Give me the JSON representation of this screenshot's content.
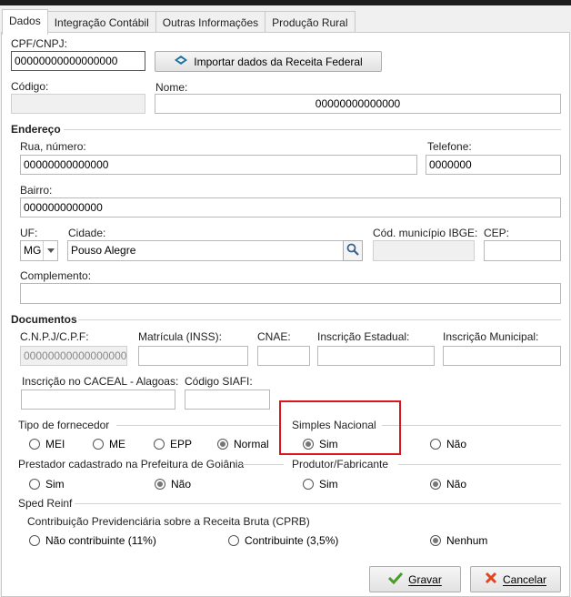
{
  "tabs": [
    "Dados",
    "Integração Contábil",
    "Outras Informações",
    "Produção Rural"
  ],
  "identificacao": {
    "cpf_label": "CPF/CNPJ:",
    "cpf_value": "00000000000000000",
    "import_button": "Importar dados da Receita Federal",
    "codigo_label": "Código:",
    "codigo_value": "",
    "nome_label": "Nome:",
    "nome_value": "00000000000000"
  },
  "endereco": {
    "title": "Endereço",
    "rua_label": "Rua, número:",
    "rua_value": "00000000000000",
    "telefone_label": "Telefone:",
    "telefone_value": "0000000",
    "bairro_label": "Bairro:",
    "bairro_value": "0000000000000",
    "uf_label": "UF:",
    "uf_value": "MG",
    "cidade_label": "Cidade:",
    "cidade_value": "Pouso Alegre",
    "ibge_label": "Cód. município IBGE:",
    "ibge_value": "",
    "cep_label": "CEP:",
    "cep_value": "",
    "complemento_label": "Complemento:",
    "complemento_value": ""
  },
  "documentos": {
    "title": "Documentos",
    "cnpj_label": "C.N.P.J/C.P.F:",
    "cnpj_value": "000000000000000000",
    "matricula_label": "Matrícula (INSS):",
    "cnae_label": "CNAE:",
    "ie_label": "Inscrição Estadual:",
    "im_label": "Inscrição Municipal:",
    "caceal_label": "Inscrição no CACEAL - Alagoas:",
    "siafi_label": "Código SIAFI:"
  },
  "tipo_fornecedor": {
    "title": "Tipo de fornecedor",
    "options": [
      "MEI",
      "ME",
      "EPP",
      "Normal"
    ],
    "selected": "Normal"
  },
  "simples_nacional": {
    "title": "Simples Nacional",
    "sim": "Sim",
    "nao": "Não",
    "selected": "Sim"
  },
  "prestador": {
    "title": "Prestador cadastrado na Prefeitura de Goiânia",
    "sim": "Sim",
    "nao": "Não",
    "selected": "Não"
  },
  "produtor": {
    "title": "Produtor/Fabricante",
    "sim": "Sim",
    "nao": "Não",
    "selected": "Não"
  },
  "sped": {
    "title": "Sped Reinf",
    "subtitle": "Contribuição Previdenciária sobre a Receita Bruta (CPRB)",
    "options": [
      "Não contribuinte (11%)",
      "Contribuinte (3,5%)",
      "Nenhum"
    ],
    "selected": "Nenhum"
  },
  "footer": {
    "gravar": "Gravar",
    "cancelar": "Cancelar"
  },
  "colors": {
    "highlight": "#d9161b",
    "ok_icon": "#4a9c2d",
    "cancel_icon": "#e0451f"
  }
}
